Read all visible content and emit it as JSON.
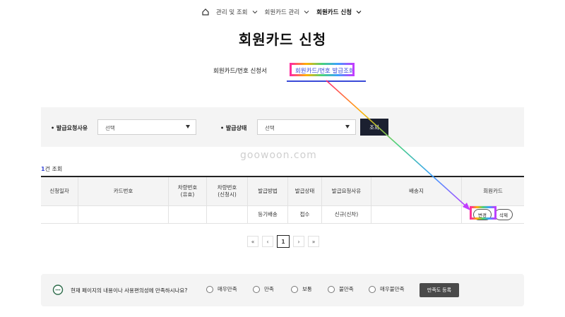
{
  "breadcrumb": {
    "items": [
      "관리 및 조회",
      "회원카드 관리",
      "회원카드 신청"
    ]
  },
  "page_title": "회원카드 신청",
  "tabs": [
    {
      "label": "회원카드/번호 신청서",
      "active": false
    },
    {
      "label": "회원카드/번호 발급조회",
      "active": true
    }
  ],
  "search": {
    "reason_label": "발급요청사유",
    "reason_value": "선택",
    "status_label": "발급상태",
    "status_value": "선택",
    "search_button": "조회"
  },
  "watermark": "goowoon.com",
  "result": {
    "count": "1",
    "suffix": "건 조회"
  },
  "table": {
    "headers": [
      "신청일자",
      "카드번호",
      "차량번호\n(유효)",
      "차량번호\n(신청시)",
      "발급방법",
      "발급상태",
      "발급요청사유",
      "배송지",
      "회원카드"
    ],
    "rows": [
      {
        "date": "",
        "card": "",
        "car_valid": "",
        "car_applied": "",
        "method": "등기배송",
        "status": "접수",
        "reason": "신규(신차)",
        "address": "",
        "edit": "변경",
        "delete": "삭제"
      }
    ]
  },
  "pagination": {
    "first": "«",
    "prev": "‹",
    "current": "1",
    "next": "›",
    "last": "»"
  },
  "survey": {
    "question": "현재 페이지의 내용이나 사용편의성에 만족하시나요?",
    "options": [
      "매우만족",
      "만족",
      "보통",
      "불만족",
      "매우불만족"
    ],
    "submit": "만족도 등록"
  },
  "colors": {
    "accent": "#3a4ad8",
    "dark_button": "#1b2030",
    "panel": "#f4f4f4"
  }
}
